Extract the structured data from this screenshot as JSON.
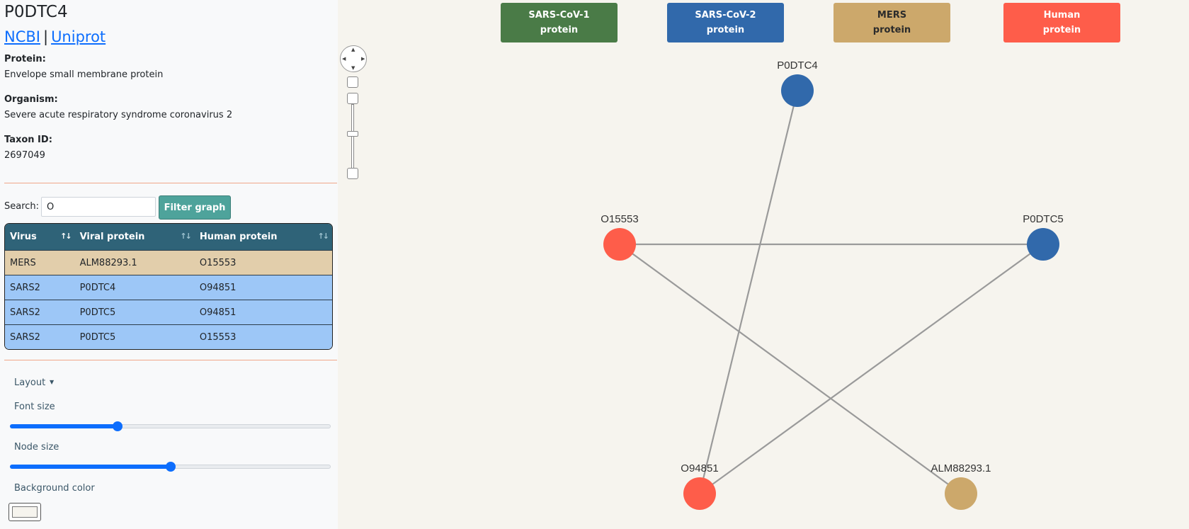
{
  "protein": {
    "id": "P0DTC4",
    "links": [
      "NCBI",
      "Uniprot"
    ],
    "link_separator": "|",
    "protein_label": "Protein:",
    "protein_value": "Envelope small membrane protein",
    "organism_label": "Organism:",
    "organism_value": "Severe acute respiratory syndrome coronavirus 2",
    "taxon_label": "Taxon ID:",
    "taxon_value": "2697049"
  },
  "search": {
    "label": "Search:",
    "value": "O",
    "button": "Filter graph"
  },
  "table": {
    "headers": [
      "Virus",
      "Viral protein",
      "Human protein"
    ],
    "sort_glyph": "↑↓",
    "rows": [
      {
        "virus": "MERS",
        "viral": "ALM88293.1",
        "human": "O15553",
        "color": "#e2ceab"
      },
      {
        "virus": "SARS2",
        "viral": "P0DTC4",
        "human": "O94851",
        "color": "#9dc7f7"
      },
      {
        "virus": "SARS2",
        "viral": "P0DTC5",
        "human": "O94851",
        "color": "#9dc7f7"
      },
      {
        "virus": "SARS2",
        "viral": "P0DTC5",
        "human": "O15553",
        "color": "#9dc7f7"
      }
    ]
  },
  "controls": {
    "layout_label": "Layout",
    "caret": "▼",
    "font_size_label": "Font size",
    "font_size_value": 0.33,
    "node_size_label": "Node size",
    "node_size_value": 0.5,
    "background_label": "Background color",
    "background_value": "#f6f4ee"
  },
  "legend": [
    {
      "line1": "SARS-CoV-1",
      "line2": "protein",
      "color": "#4a7b47"
    },
    {
      "line1": "SARS-CoV-2",
      "line2": "protein",
      "color": "#3169ab"
    },
    {
      "line1": "MERS",
      "line2": "protein",
      "color": "#cca86b",
      "text_color": "#2b2b2b"
    },
    {
      "line1": "Human",
      "line2": "protein",
      "color": "#fe5d4a"
    }
  ],
  "graph": {
    "edge_color": "#9a9a9a",
    "nodes": [
      {
        "id": "P0DTC4",
        "label": "P0DTC4",
        "color": "#3169ab"
      },
      {
        "id": "O15553",
        "label": "O15553",
        "color": "#fe5d4a"
      },
      {
        "id": "P0DTC5",
        "label": "P0DTC5",
        "color": "#3169ab"
      },
      {
        "id": "O94851",
        "label": "O94851",
        "color": "#fe5d4a"
      },
      {
        "id": "ALM88293.1",
        "label": "ALM88293.1",
        "color": "#cca86b"
      }
    ],
    "edges": [
      [
        "P0DTC4",
        "O94851"
      ],
      [
        "O15553",
        "P0DTC5"
      ],
      [
        "O15553",
        "ALM88293.1"
      ],
      [
        "P0DTC5",
        "O94851"
      ]
    ]
  }
}
